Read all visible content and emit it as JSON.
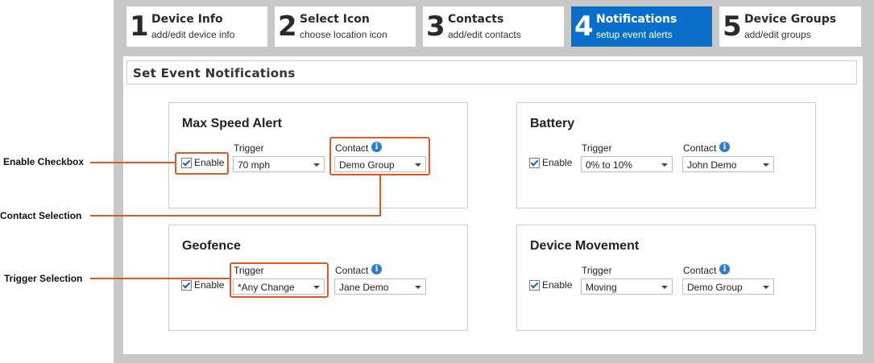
{
  "steps": [
    {
      "num": "1",
      "title": "Device Info",
      "sub": "add/edit device info"
    },
    {
      "num": "2",
      "title": "Select Icon",
      "sub": "choose location icon"
    },
    {
      "num": "3",
      "title": "Contacts",
      "sub": "add/edit contacts"
    },
    {
      "num": "4",
      "title": "Notifications",
      "sub": "setup event alerts"
    },
    {
      "num": "5",
      "title": "Device Groups",
      "sub": "add/edit groups"
    }
  ],
  "header": {
    "title": "Set Event Notifications"
  },
  "labels": {
    "enable": "Enable",
    "trigger": "Trigger",
    "contact": "Contact",
    "info": "i"
  },
  "cards": [
    {
      "title": "Max Speed Alert",
      "trigger": "70 mph",
      "contact": "Demo Group"
    },
    {
      "title": "Battery",
      "trigger": "0% to 10%",
      "contact": "John Demo"
    },
    {
      "title": "Geofence",
      "trigger": "*Any Change",
      "contact": "Jane Demo"
    },
    {
      "title": "Device Movement",
      "trigger": "Moving",
      "contact": "Demo Group"
    }
  ],
  "callouts": {
    "enable": "Enable Checkbox",
    "contact": "Contact Selection",
    "trigger": "Trigger Selection"
  },
  "colors": {
    "active_step": "#0a6fc9",
    "frame": "#c8c8c8",
    "callout": "#e0582a",
    "info": "#2a7fd4"
  },
  "icons": {
    "checkbox": "checkmark-icon",
    "info": "info-icon",
    "dropdown": "chevron-down-icon"
  }
}
